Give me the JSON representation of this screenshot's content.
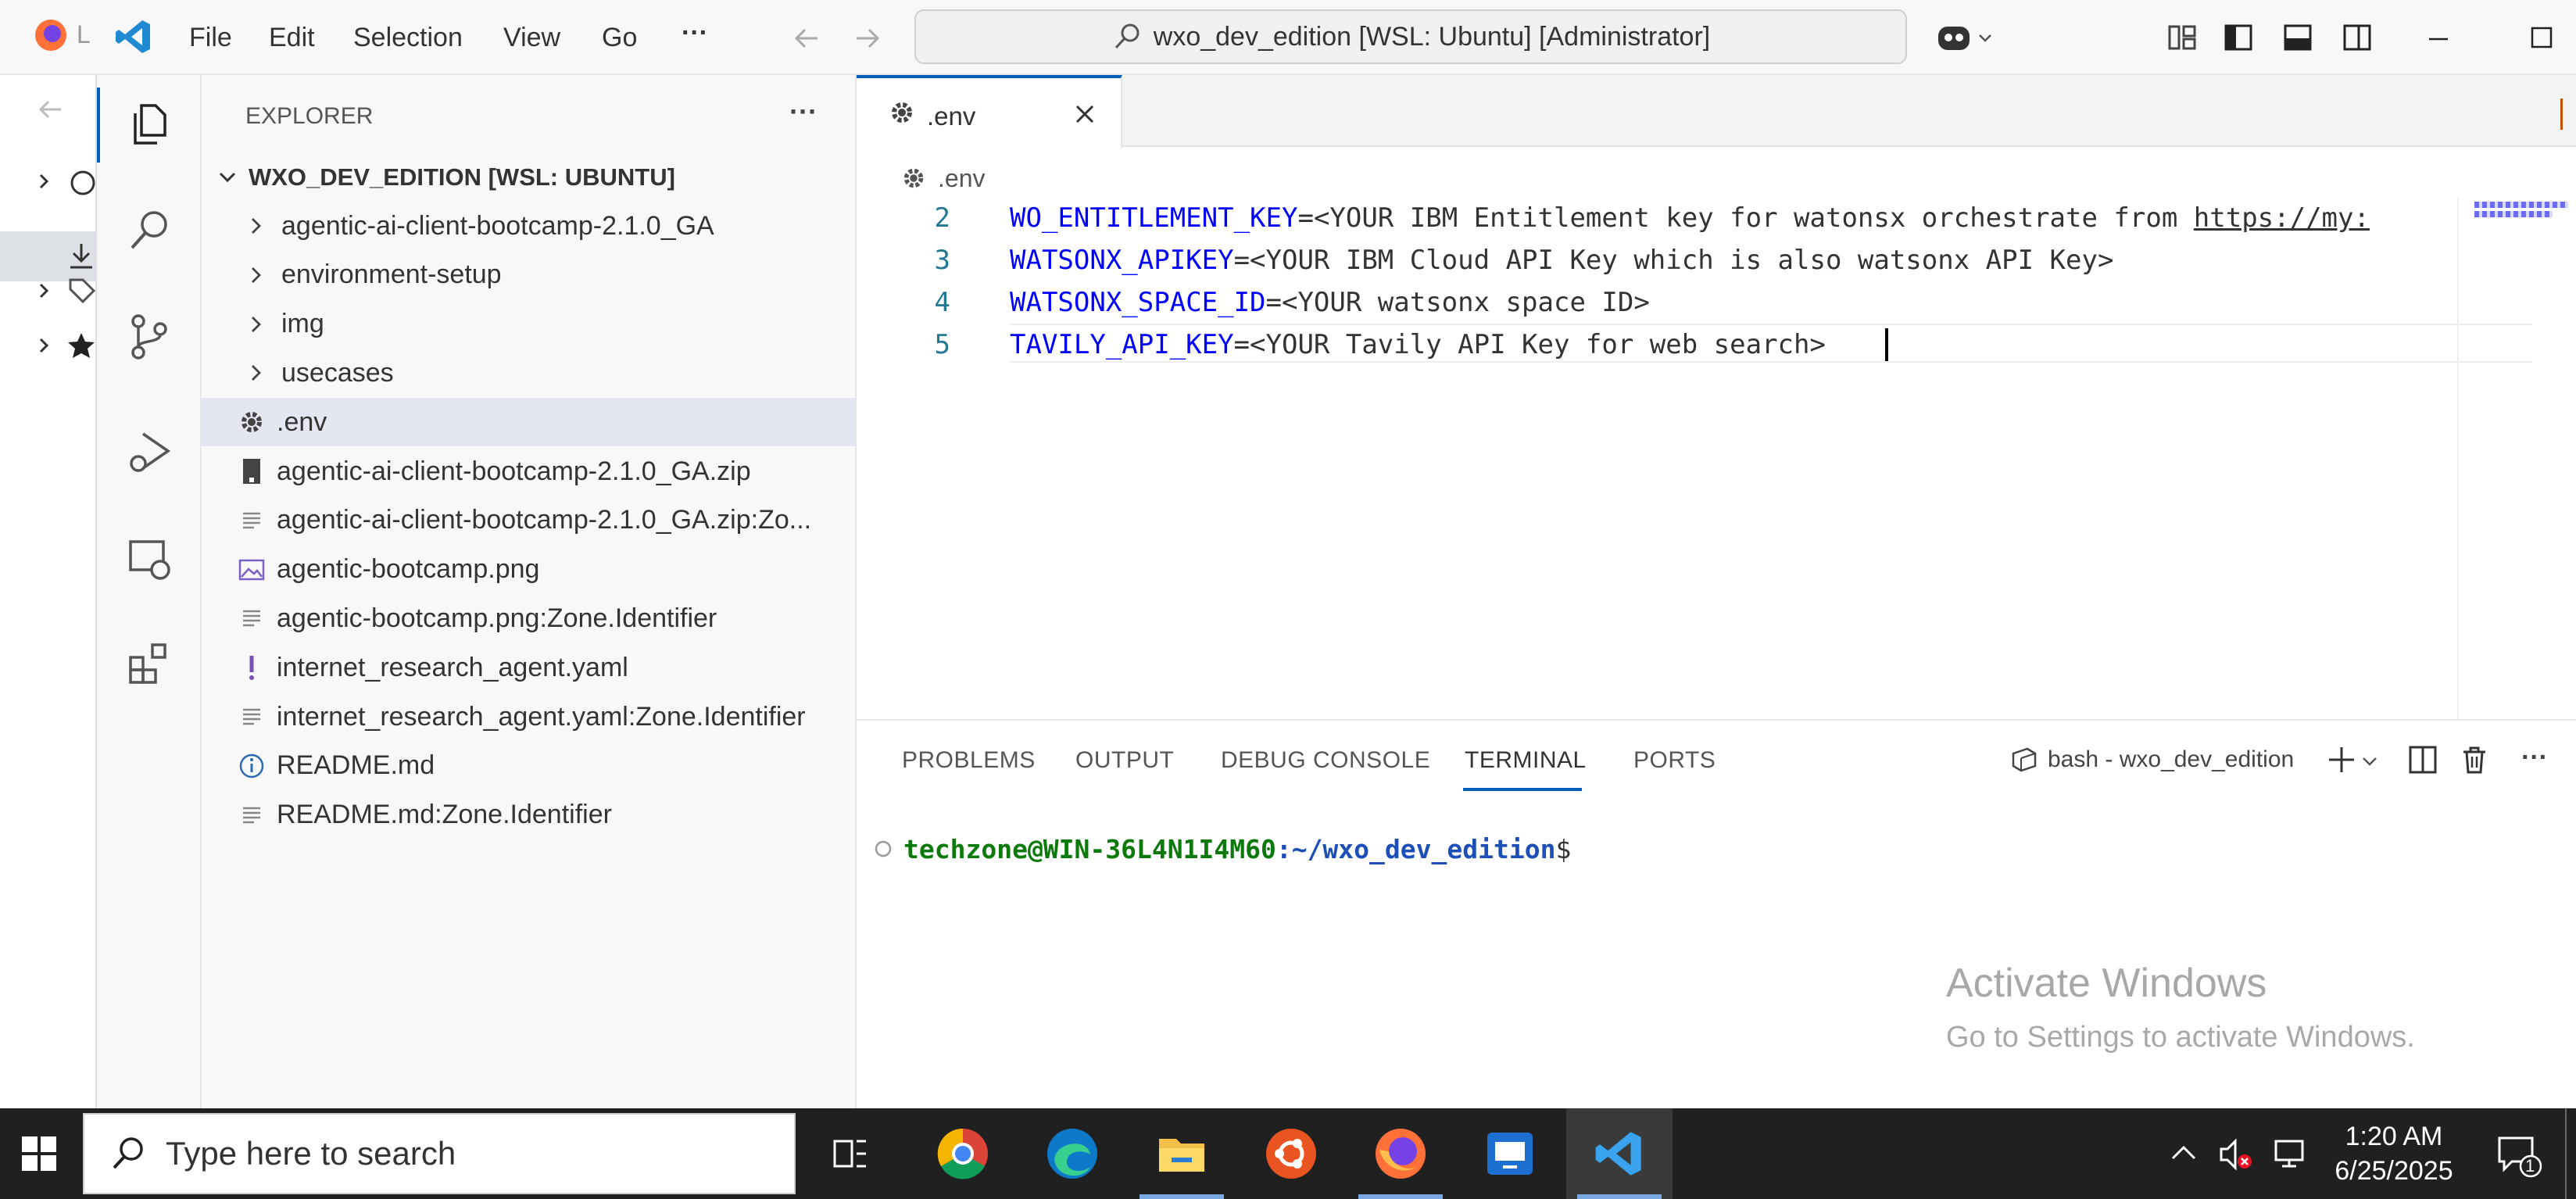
{
  "titlebar": {
    "firefox_label": "L",
    "menu": [
      "File",
      "Edit",
      "Selection",
      "View",
      "Go"
    ],
    "more": "···",
    "command_center": "wxo_dev_edition [WSL: Ubuntu] [Administrator]"
  },
  "sidebar": {
    "header": "EXPLORER",
    "more": "···",
    "workspace": "WXO_DEV_EDITION [WSL: UBUNTU]",
    "items": [
      {
        "label": "agentic-ai-client-bootcamp-2.1.0_GA",
        "type": "folder"
      },
      {
        "label": "environment-setup",
        "type": "folder"
      },
      {
        "label": "img",
        "type": "folder"
      },
      {
        "label": "usecases",
        "type": "folder"
      },
      {
        "label": ".env",
        "type": "gear"
      },
      {
        "label": "agentic-ai-client-bootcamp-2.1.0_GA.zip",
        "type": "zip"
      },
      {
        "label": "agentic-ai-client-bootcamp-2.1.0_GA.zip:Zo...",
        "type": "text"
      },
      {
        "label": "agentic-bootcamp.png",
        "type": "image"
      },
      {
        "label": "agentic-bootcamp.png:Zone.Identifier",
        "type": "text"
      },
      {
        "label": "internet_research_agent.yaml",
        "type": "yaml"
      },
      {
        "label": "internet_research_agent.yaml:Zone.Identifier",
        "type": "text"
      },
      {
        "label": "README.md",
        "type": "info"
      },
      {
        "label": "README.md:Zone.Identifier",
        "type": "text"
      }
    ]
  },
  "editor": {
    "tab_label": ".env",
    "breadcrumb": ".env",
    "lines": [
      {
        "num": "2",
        "key": "WO_ENTITLEMENT_KEY",
        "value": "=<YOUR IBM Entitlement key for watonsx orchestrate from ",
        "link": "https://my:"
      },
      {
        "num": "3",
        "key": "WATSONX_APIKEY",
        "value": "=<YOUR IBM Cloud API Key which is also watsonx API Key>",
        "link": ""
      },
      {
        "num": "4",
        "key": "WATSONX_SPACE_ID",
        "value": "=<YOUR watsonx space ID>",
        "link": ""
      },
      {
        "num": "5",
        "key": "TAVILY_API_KEY",
        "value": "=<YOUR Tavily API Key for web search>",
        "link": ""
      }
    ]
  },
  "panel": {
    "tabs": [
      "PROBLEMS",
      "OUTPUT",
      "DEBUG CONSOLE",
      "TERMINAL",
      "PORTS"
    ],
    "active_tab": "TERMINAL",
    "terminal_name": "bash - wxo_dev_edition",
    "prompt_user": "techzone@WIN-36L4N1I4M60",
    "prompt_path": ":~/wxo_dev_edition",
    "prompt_symbol": "$"
  },
  "watermark": {
    "title": "Activate Windows",
    "subtitle": "Go to Settings to activate Windows."
  },
  "taskbar": {
    "search_placeholder": "Type here to search",
    "time": "1:20 AM",
    "date": "6/25/2025",
    "notification_count": "1"
  },
  "colors": {
    "accent": "#005fb8",
    "env_key": "#0000ff",
    "prompt_user": "#0b7a0b",
    "prompt_path": "#1d4fb8"
  }
}
